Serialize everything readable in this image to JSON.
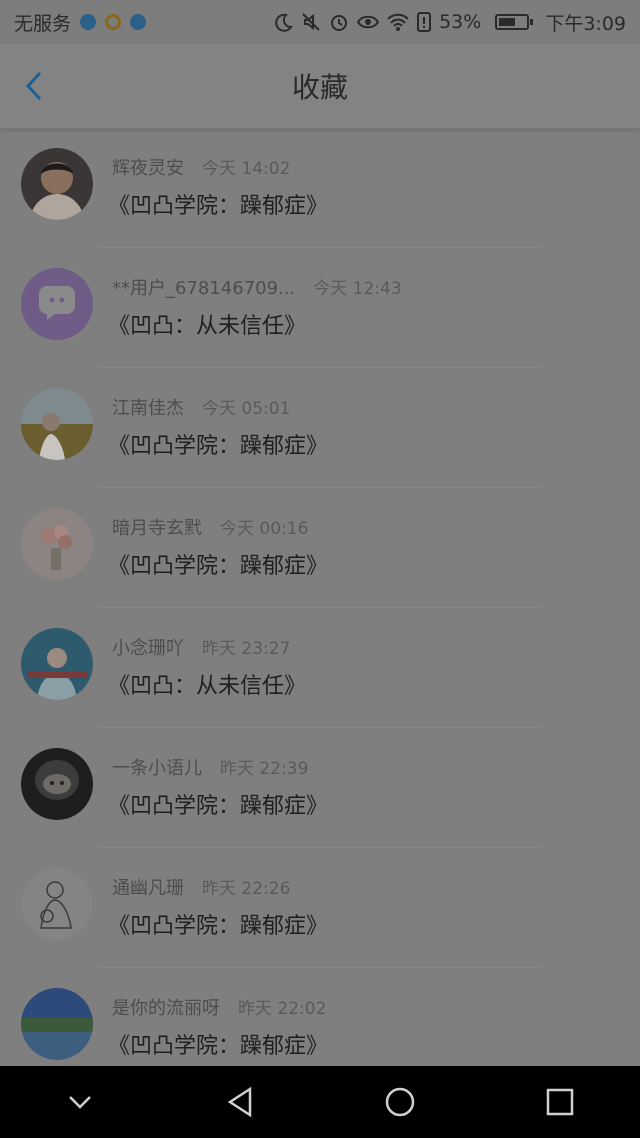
{
  "status_bar": {
    "carrier": "无服务",
    "battery": "53%",
    "time": "下午3:09"
  },
  "header": {
    "title": "收藏"
  },
  "items": [
    {
      "name": "辉夜灵安",
      "time": "今天 14:02",
      "title": "《凹凸学院：躁郁症》"
    },
    {
      "name": "**用户_678146709...",
      "time": "今天 12:43",
      "title": "《凹凸：从未信任》"
    },
    {
      "name": "江南佳杰",
      "time": "今天 05:01",
      "title": "《凹凸学院：躁郁症》"
    },
    {
      "name": "暗月寺玄黓",
      "time": "今天 00:16",
      "title": "《凹凸学院：躁郁症》"
    },
    {
      "name": "小念珊吖",
      "time": "昨天 23:27",
      "title": "《凹凸：从未信任》"
    },
    {
      "name": "一条小语儿",
      "time": "昨天 22:39",
      "title": "《凹凸学院：躁郁症》"
    },
    {
      "name": "通幽凡珊",
      "time": "昨天 22:26",
      "title": "《凹凸学院：躁郁症》"
    },
    {
      "name": "是你的流丽呀",
      "time": "昨天 22:02",
      "title": "《凹凸学院：躁郁症》"
    }
  ],
  "colors": {
    "back_arrow": "#1a5f95",
    "default_avatar_bg": "#6e5c86"
  }
}
